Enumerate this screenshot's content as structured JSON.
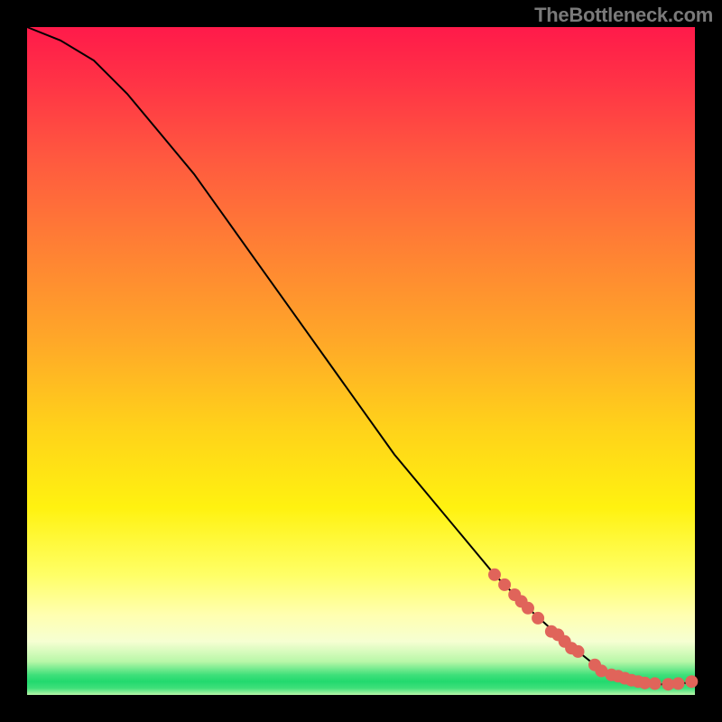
{
  "watermark": "TheBottleneck.com",
  "chart_data": {
    "type": "line",
    "title": "",
    "xlabel": "",
    "ylabel": "",
    "xlim": [
      0,
      100
    ],
    "ylim": [
      0,
      100
    ],
    "grid": false,
    "series": [
      {
        "name": "curve",
        "x": [
          0,
          5,
          10,
          15,
          20,
          25,
          30,
          35,
          40,
          45,
          50,
          55,
          60,
          65,
          70,
          75,
          80,
          85,
          88,
          90,
          92,
          94,
          96,
          98,
          100
        ],
        "y": [
          100,
          98,
          95,
          90,
          84,
          78,
          71,
          64,
          57,
          50,
          43,
          36,
          30,
          24,
          18,
          13,
          8.5,
          4.5,
          2.8,
          2.0,
          1.7,
          1.6,
          1.6,
          1.7,
          2.0
        ]
      }
    ],
    "markers": {
      "name": "highlighted-points",
      "color": "#e0645a",
      "x": [
        70,
        71.5,
        73,
        74,
        75,
        76.5,
        78.5,
        79.5,
        80.5,
        81.5,
        82.5,
        85,
        86,
        87.5,
        88.5,
        89.5,
        90.5,
        91.5,
        92.5,
        94,
        96,
        97.5,
        99.5
      ],
      "y": [
        18,
        16.5,
        15,
        14,
        13,
        11.5,
        9.5,
        9,
        8,
        7,
        6.5,
        4.5,
        3.6,
        3,
        2.8,
        2.5,
        2.2,
        2.0,
        1.8,
        1.7,
        1.6,
        1.7,
        2.0
      ]
    },
    "gradient_bands": [
      {
        "pos": 0.0,
        "color": "#ff1a4a"
      },
      {
        "pos": 0.2,
        "color": "#ff5a3f"
      },
      {
        "pos": 0.47,
        "color": "#ffa828"
      },
      {
        "pos": 0.72,
        "color": "#fff210"
      },
      {
        "pos": 0.92,
        "color": "#f6ffd2"
      },
      {
        "pos": 0.97,
        "color": "#22d96e"
      },
      {
        "pos": 1.0,
        "color": "#b8f7a8"
      }
    ]
  }
}
